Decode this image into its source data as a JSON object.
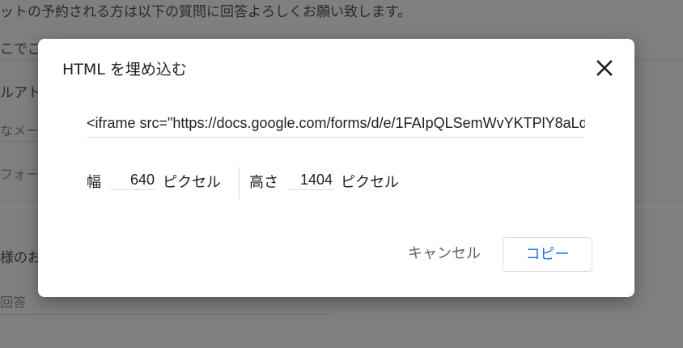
{
  "background": {
    "intro_text": "ットの予約される方は以下の質問に回答よろしくお願い致します。",
    "q1_fragment": "こでご",
    "q2_fragment": "ルアト",
    "q2_hint_fragment": "なメー",
    "q3_fragment": "フォー",
    "q4_fragment": "様のお",
    "answer_placeholder_fragment": "回答"
  },
  "dialog": {
    "title": "HTML を埋め込む",
    "embed_code": "<iframe src=\"https://docs.google.com/forms/d/e/1FAIpQLSemWvYKTPlY8aLd",
    "width_label": "幅",
    "width_value": "640",
    "width_unit": "ピクセル",
    "height_label": "高さ",
    "height_value": "1404",
    "height_unit": "ピクセル",
    "cancel_label": "キャンセル",
    "copy_label": "コピー"
  },
  "icons": {
    "close": "close-icon"
  },
  "colors": {
    "accent": "#1a73e8",
    "overlay": "#7f7f7f",
    "dialog_bg": "#ffffff"
  }
}
